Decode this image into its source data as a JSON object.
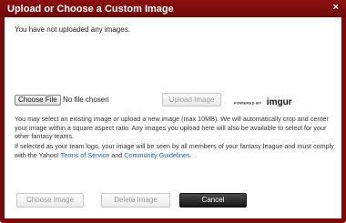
{
  "dialog": {
    "title": "Upload or Choose a Custom Image",
    "close_glyph": "×",
    "close_icon": "close-icon"
  },
  "content": {
    "empty_message": "You have not uploaded any images.",
    "choose_file_label": "Choose File",
    "no_file_text": "No file chosen",
    "upload_button_label": "Upload Image",
    "powered_by_text": "POWERED BY",
    "imgur_text": "imgur",
    "info_paragraph": "You may select an existing image or upload a new image (max 10MB). We will automatically crop and center your image within a square aspect ratio. Any images you upload here will also be available to select for your other fantasy teams.",
    "logo_notice_prefix": "If selected as your team logo, your image will be seen by all members of your fantasy league and must comply with the Yahoo!",
    "terms_link": "Terms of Service",
    "and_text": "and",
    "guidelines_link": "Community Guidelines",
    "period": "."
  },
  "footer": {
    "choose_image_label": "Choose Image",
    "delete_image_label": "Delete Image",
    "cancel_label": "Cancel"
  },
  "colors": {
    "frame": "#7b0a0a",
    "link": "#1a5aa8",
    "cancel_button": "#1c1c1c"
  }
}
